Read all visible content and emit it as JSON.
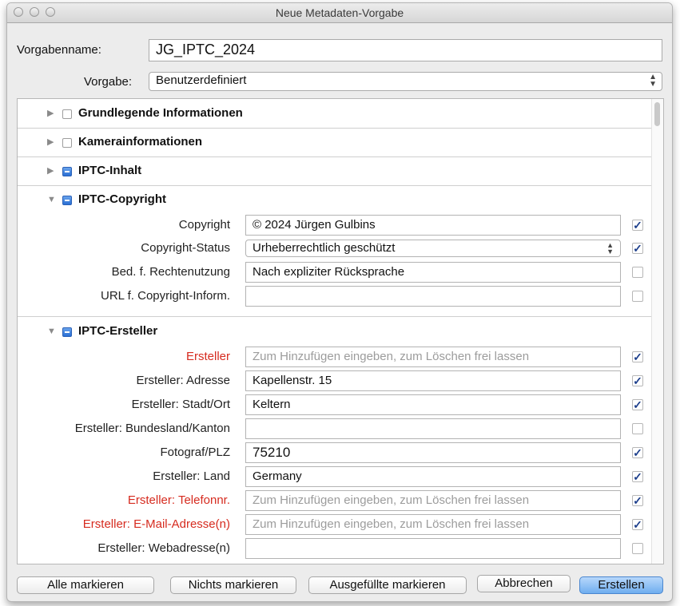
{
  "window": {
    "title": "Neue Metadaten-Vorgabe"
  },
  "preset_name": {
    "label": "Vorgabenname:",
    "value": "JG_IPTC_2024"
  },
  "preset": {
    "label": "Vorgabe:",
    "value": "Benutzerdefiniert"
  },
  "sections": {
    "basic": {
      "title": "Grundlegende Informationen",
      "expanded": false,
      "checkbox": "unchecked"
    },
    "camera": {
      "title": "Kamerainformationen",
      "expanded": false,
      "checkbox": "unchecked"
    },
    "iptc_content": {
      "title": "IPTC-Inhalt",
      "expanded": false,
      "checkbox": "mixed"
    },
    "iptc_copyright": {
      "title": "IPTC-Copyright",
      "expanded": true,
      "checkbox": "mixed",
      "rows": [
        {
          "label": "Copyright",
          "value": "© 2024 Jürgen Gulbins",
          "checked": true,
          "type": "text"
        },
        {
          "label": "Copyright-Status",
          "value": "Urheberrechtlich geschützt",
          "checked": true,
          "type": "select"
        },
        {
          "label": "Bed. f. Rechtenutzung",
          "value": "Nach expliziter Rücksprache",
          "checked": false,
          "type": "text"
        },
        {
          "label": "URL f. Copyright-Inform.",
          "value": "",
          "checked": false,
          "type": "text"
        }
      ]
    },
    "iptc_creator": {
      "title": "IPTC-Ersteller",
      "expanded": true,
      "checkbox": "mixed",
      "rows": [
        {
          "label": "Ersteller",
          "value": "",
          "placeholder": "Zum Hinzufügen eingeben, zum Löschen frei lassen",
          "checked": true,
          "highlight": true
        },
        {
          "label": "Ersteller: Adresse",
          "value": "Kapellenstr. 15",
          "checked": true
        },
        {
          "label": "Ersteller: Stadt/Ort",
          "value": "Keltern",
          "checked": true
        },
        {
          "label": "Ersteller: Bundesland/Kanton",
          "value": "",
          "checked": false
        },
        {
          "label": "Fotograf/PLZ",
          "value": "75210",
          "checked": true
        },
        {
          "label": "Ersteller: Land",
          "value": "Germany",
          "checked": true
        },
        {
          "label": "Ersteller: Telefonnr.",
          "value": "",
          "placeholder": "Zum Hinzufügen eingeben, zum Löschen frei lassen",
          "checked": true,
          "highlight": true
        },
        {
          "label": "Ersteller: E-Mail-Adresse(n)",
          "value": "",
          "placeholder": "Zum Hinzufügen eingeben, zum Löschen frei lassen",
          "checked": true,
          "highlight": true
        },
        {
          "label": "Ersteller: Webadresse(n)",
          "value": "",
          "checked": false
        }
      ]
    }
  },
  "buttons": {
    "select_all": "Alle markieren",
    "select_none": "Nichts markieren",
    "select_filled": "Ausgefüllte markieren",
    "cancel": "Abbrechen",
    "create": "Erstellen"
  },
  "colors": {
    "required_label": "#d62b1f",
    "checkmark": "#1d3f8c",
    "default_button": "#6faeef"
  }
}
